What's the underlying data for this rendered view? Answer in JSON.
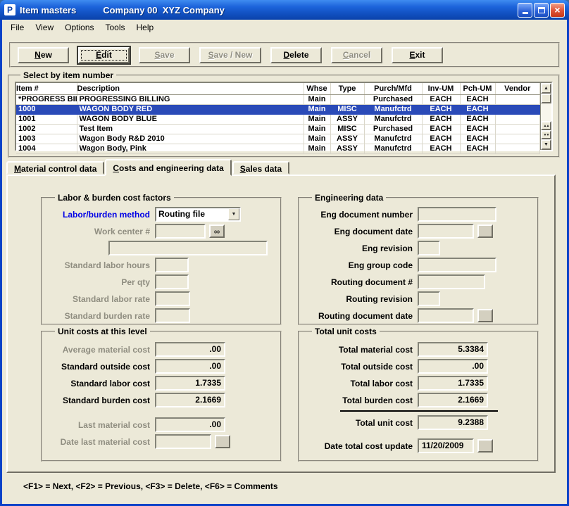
{
  "window": {
    "icon_letter": "P",
    "title": "Item masters",
    "subtitle": "Company 00  XYZ Company"
  },
  "menubar": {
    "items": [
      {
        "label": "File"
      },
      {
        "label": "View"
      },
      {
        "label": "Options"
      },
      {
        "label": "Tools"
      },
      {
        "label": "Help"
      }
    ]
  },
  "toolbar": {
    "buttons": [
      {
        "u": "N",
        "rest": "ew",
        "state": "enabled"
      },
      {
        "u": "E",
        "rest": "dit",
        "state": "active"
      },
      {
        "u": "S",
        "rest": "ave",
        "state": "disabled"
      },
      {
        "u": "S",
        "rest": "ave / New",
        "state": "disabled"
      },
      {
        "u": "D",
        "rest": "elete",
        "state": "enabled"
      },
      {
        "u": "C",
        "rest": "ancel",
        "state": "disabled"
      },
      {
        "u": "E",
        "rest": "xit",
        "state": "enabled"
      }
    ]
  },
  "item_list": {
    "legend": "Select by item number",
    "columns": [
      "Item #",
      "Description",
      "Whse",
      "Type",
      "Purch/Mfd",
      "Inv-UM",
      "Pch-UM",
      "Vendor"
    ],
    "rows": [
      {
        "cells": [
          "*PROGRESS BILL",
          "PROGRESSING BILLING",
          "Main",
          "",
          "Purchased",
          "EACH",
          "EACH",
          ""
        ],
        "selected": false
      },
      {
        "cells": [
          "1000",
          "WAGON BODY RED",
          "Main",
          "MISC",
          "Manufctrd",
          "EACH",
          "EACH",
          ""
        ],
        "selected": true
      },
      {
        "cells": [
          "1001",
          "WAGON BODY BLUE",
          "Main",
          "ASSY",
          "Manufctrd",
          "EACH",
          "EACH",
          ""
        ],
        "selected": false
      },
      {
        "cells": [
          "1002",
          "Test Item",
          "Main",
          "MISC",
          "Purchased",
          "EACH",
          "EACH",
          ""
        ],
        "selected": false
      },
      {
        "cells": [
          "1003",
          "Wagon Body R&D 2010",
          "Main",
          "ASSY",
          "Manufctrd",
          "EACH",
          "EACH",
          ""
        ],
        "selected": false
      },
      {
        "cells": [
          "1004",
          "Wagon Body, Pink",
          "Main",
          "ASSY",
          "Manufctrd",
          "EACH",
          "EACH",
          ""
        ],
        "selected": false
      }
    ]
  },
  "tabs": [
    {
      "u": "M",
      "rest": "aterial control data",
      "active": false
    },
    {
      "u": "C",
      "rest": "osts and engineering data",
      "active": true
    },
    {
      "u": "S",
      "rest": "ales data",
      "active": false
    }
  ],
  "labor_group": {
    "legend": "Labor & burden cost factors",
    "method": {
      "label": "Labor/burden method",
      "value": "Routing file"
    },
    "work_center": {
      "label": "Work center #",
      "value": ""
    },
    "extra_field_value": "",
    "std_labor_hours": {
      "label": "Standard labor hours",
      "value": ""
    },
    "per_qty": {
      "label": "Per qty",
      "value": ""
    },
    "std_labor_rate": {
      "label": "Standard labor rate",
      "value": ""
    },
    "std_burden_rate": {
      "label": "Standard burden rate",
      "value": ""
    }
  },
  "engineering_group": {
    "legend": "Engineering data",
    "fields": [
      {
        "label": "Eng document number",
        "value": ""
      },
      {
        "label": "Eng document date",
        "value": ""
      },
      {
        "label": "Eng revision",
        "value": ""
      },
      {
        "label": "Eng group code",
        "value": ""
      },
      {
        "label": "Routing document #",
        "value": ""
      },
      {
        "label": "Routing revision",
        "value": ""
      },
      {
        "label": "Routing document date",
        "value": ""
      }
    ]
  },
  "unit_costs_group": {
    "legend": "Unit costs at this level",
    "rows": [
      {
        "label": "Average material cost",
        "value": ".00",
        "disabled": true
      },
      {
        "label": "Standard outside cost",
        "value": ".00",
        "disabled": false
      },
      {
        "label": "Standard labor cost",
        "value": "1.7335",
        "disabled": false
      },
      {
        "label": "Standard burden cost",
        "value": "2.1669",
        "disabled": false
      },
      {
        "label": "Last material cost",
        "value": ".00",
        "disabled": true
      },
      {
        "label": "Date last material cost",
        "value": "",
        "disabled": true
      }
    ]
  },
  "total_costs_group": {
    "legend": "Total unit costs",
    "rows": [
      {
        "label": "Total material cost",
        "value": "5.3384"
      },
      {
        "label": "Total outside cost",
        "value": ".00"
      },
      {
        "label": "Total labor cost",
        "value": "1.7335"
      },
      {
        "label": "Total burden cost",
        "value": "2.1669"
      },
      {
        "label": "Total unit cost",
        "value": "9.2388"
      },
      {
        "label": "Date total cost update",
        "value": "11/20/2009"
      }
    ]
  },
  "footer": {
    "hint": "<F1> = Next, <F2> = Previous, <F3> = Delete, <F6> = Comments"
  },
  "icons": {
    "close": "×",
    "dropdown": "▼",
    "up": "▲",
    "down": "▼",
    "dbl_up": "▲▲",
    "dbl_down": "▼▼",
    "binoculars": "∞"
  },
  "colors": {
    "titlebar": "#1A5CD8",
    "frame": "#0842C8",
    "selection": "#2A4AB8",
    "label_blue": "#0000E6",
    "disabled_text": "#8F8D80",
    "surface": "#ECE9D8"
  }
}
